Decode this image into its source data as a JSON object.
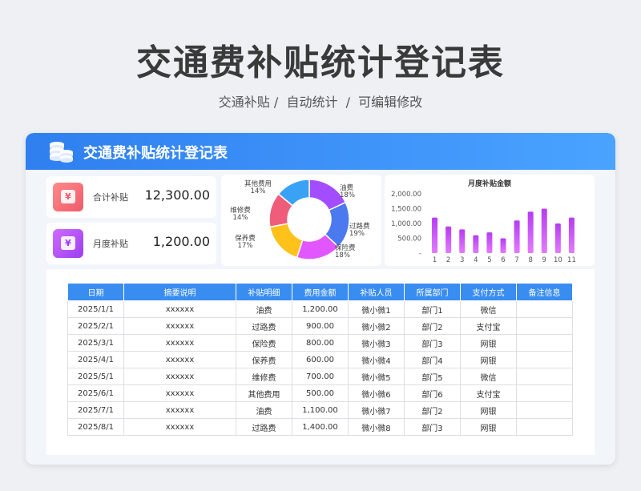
{
  "page": {
    "title": "交通费补贴统计登记表",
    "subtitle": "交通补贴 /  自动统计  /  可编辑修改"
  },
  "card": {
    "title": "交通费补贴统计登记表"
  },
  "stats": [
    {
      "label": "合计补贴",
      "value": "12,300.00",
      "icon": "yen-icon",
      "color": "#f05a6a"
    },
    {
      "label": "月度补贴",
      "value": "1,200.00",
      "icon": "yen-icon",
      "color": "#9b3df0"
    }
  ],
  "chart_data": [
    {
      "type": "pie",
      "donut": true,
      "slices": [
        {
          "name": "油费",
          "label": "油费",
          "percent_label": "18%",
          "value": 18,
          "color": "#a24dff"
        },
        {
          "name": "过路费",
          "label": "过路费",
          "percent_label": "19%",
          "value": 19,
          "color": "#4a79f0"
        },
        {
          "name": "保险费",
          "label": "保险费",
          "percent_label": "18%",
          "value": 18,
          "color": "#e256ff"
        },
        {
          "name": "保养费",
          "label": "保养费",
          "percent_label": "17%",
          "value": 17,
          "color": "#ffc21a"
        },
        {
          "name": "维修费",
          "label": "维修费",
          "percent_label": "14%",
          "value": 14,
          "color": "#f05d7a"
        },
        {
          "name": "其他费用",
          "label": "其他费用",
          "percent_label": "14%",
          "value": 14,
          "color": "#3aa2f5"
        }
      ]
    },
    {
      "type": "bar",
      "title": "月度补贴金额",
      "categories": [
        "1",
        "2",
        "3",
        "4",
        "5",
        "6",
        "7",
        "8",
        "9",
        "10",
        "11"
      ],
      "values": [
        1200,
        900,
        800,
        600,
        700,
        500,
        1100,
        1400,
        1500,
        1000,
        1200
      ],
      "yticks": [
        "2,000.00",
        "1,500.00",
        "1,000.00",
        "500.00",
        "-"
      ],
      "ylim": [
        0,
        2000
      ],
      "bar_color": "#c553f5"
    }
  ],
  "table": {
    "headers": [
      "日期",
      "摘要说明",
      "补贴明细",
      "费用金额",
      "补贴人员",
      "所属部门",
      "支付方式",
      "备注信息"
    ],
    "rows": [
      [
        "2025/1/1",
        "xxxxxx",
        "油费",
        "1,200.00",
        "微小微1",
        "部门1",
        "微信",
        ""
      ],
      [
        "2025/2/1",
        "xxxxxx",
        "过路费",
        "900.00",
        "微小微2",
        "部门2",
        "支付宝",
        ""
      ],
      [
        "2025/3/1",
        "xxxxxx",
        "保险费",
        "800.00",
        "微小微3",
        "部门3",
        "网银",
        ""
      ],
      [
        "2025/4/1",
        "xxxxxx",
        "保养费",
        "600.00",
        "微小微4",
        "部门4",
        "网银",
        ""
      ],
      [
        "2025/5/1",
        "xxxxxx",
        "维修费",
        "700.00",
        "微小微5",
        "部门5",
        "微信",
        ""
      ],
      [
        "2025/6/1",
        "xxxxxx",
        "其他费用",
        "500.00",
        "微小微6",
        "部门6",
        "支付宝",
        ""
      ],
      [
        "2025/7/1",
        "xxxxxx",
        "油费",
        "1,100.00",
        "微小微7",
        "部门2",
        "网银",
        ""
      ],
      [
        "2025/8/1",
        "xxxxxx",
        "过路费",
        "1,400.00",
        "微小微8",
        "部门3",
        "网银",
        ""
      ]
    ]
  },
  "colors": {
    "header_gradient_start": "#2f7ff0",
    "header_gradient_end": "#4aa3ff",
    "table_header": "#3a8df0"
  }
}
